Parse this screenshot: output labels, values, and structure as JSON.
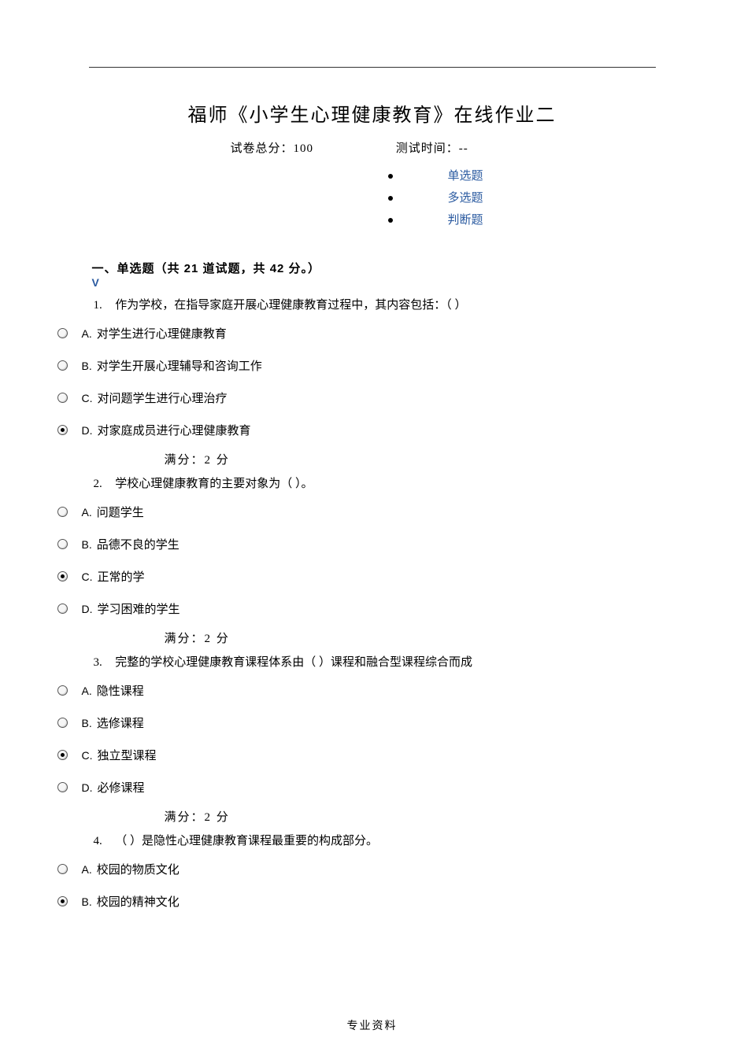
{
  "title": "福师《小学生心理健康教育》在线作业二",
  "meta": {
    "total_score_label": "试卷总分：",
    "total_score_value": "100",
    "test_time_label": "测试时间：",
    "test_time_value": "--"
  },
  "nav": {
    "single": "单选题",
    "multi": "多选题",
    "judge": "判断题"
  },
  "section_header": "一、单选题（共  21  道试题，共  42  分。）",
  "v_mark": "V",
  "score_line": "满分：2    分",
  "questions": [
    {
      "num": "1.",
      "text": "作为学校，在指导家庭开展心理健康教育过程中，其内容包括：（ ）",
      "selected": 3,
      "options": [
        {
          "letter": "A.",
          "text": "对学生进行心理健康教育"
        },
        {
          "letter": "B.",
          "text": "对学生开展心理辅导和咨询工作"
        },
        {
          "letter": "C.",
          "text": "对问题学生进行心理治疗"
        },
        {
          "letter": "D.",
          "text": "对家庭成员进行心理健康教育"
        }
      ]
    },
    {
      "num": "2.",
      "text": "学校心理健康教育的主要对象为（ ）。",
      "selected": 2,
      "options": [
        {
          "letter": "A.",
          "text": "问题学生"
        },
        {
          "letter": "B.",
          "text": "品德不良的学生"
        },
        {
          "letter": "C.",
          "text": "正常的学"
        },
        {
          "letter": "D.",
          "text": "学习困难的学生"
        }
      ]
    },
    {
      "num": "3.",
      "text": "完整的学校心理健康教育课程体系由（ ）课程和融合型课程综合而成",
      "selected": 2,
      "options": [
        {
          "letter": "A.",
          "text": "隐性课程"
        },
        {
          "letter": "B.",
          "text": "选修课程"
        },
        {
          "letter": "C.",
          "text": "独立型课程"
        },
        {
          "letter": "D.",
          "text": "必修课程"
        }
      ]
    },
    {
      "num": "4.",
      "text": "（ ）是隐性心理健康教育课程最重要的构成部分。",
      "selected": 1,
      "options": [
        {
          "letter": "A.",
          "text": "校园的物质文化"
        },
        {
          "letter": "B.",
          "text": "校园的精神文化"
        }
      ]
    }
  ],
  "footer": "专业资料"
}
